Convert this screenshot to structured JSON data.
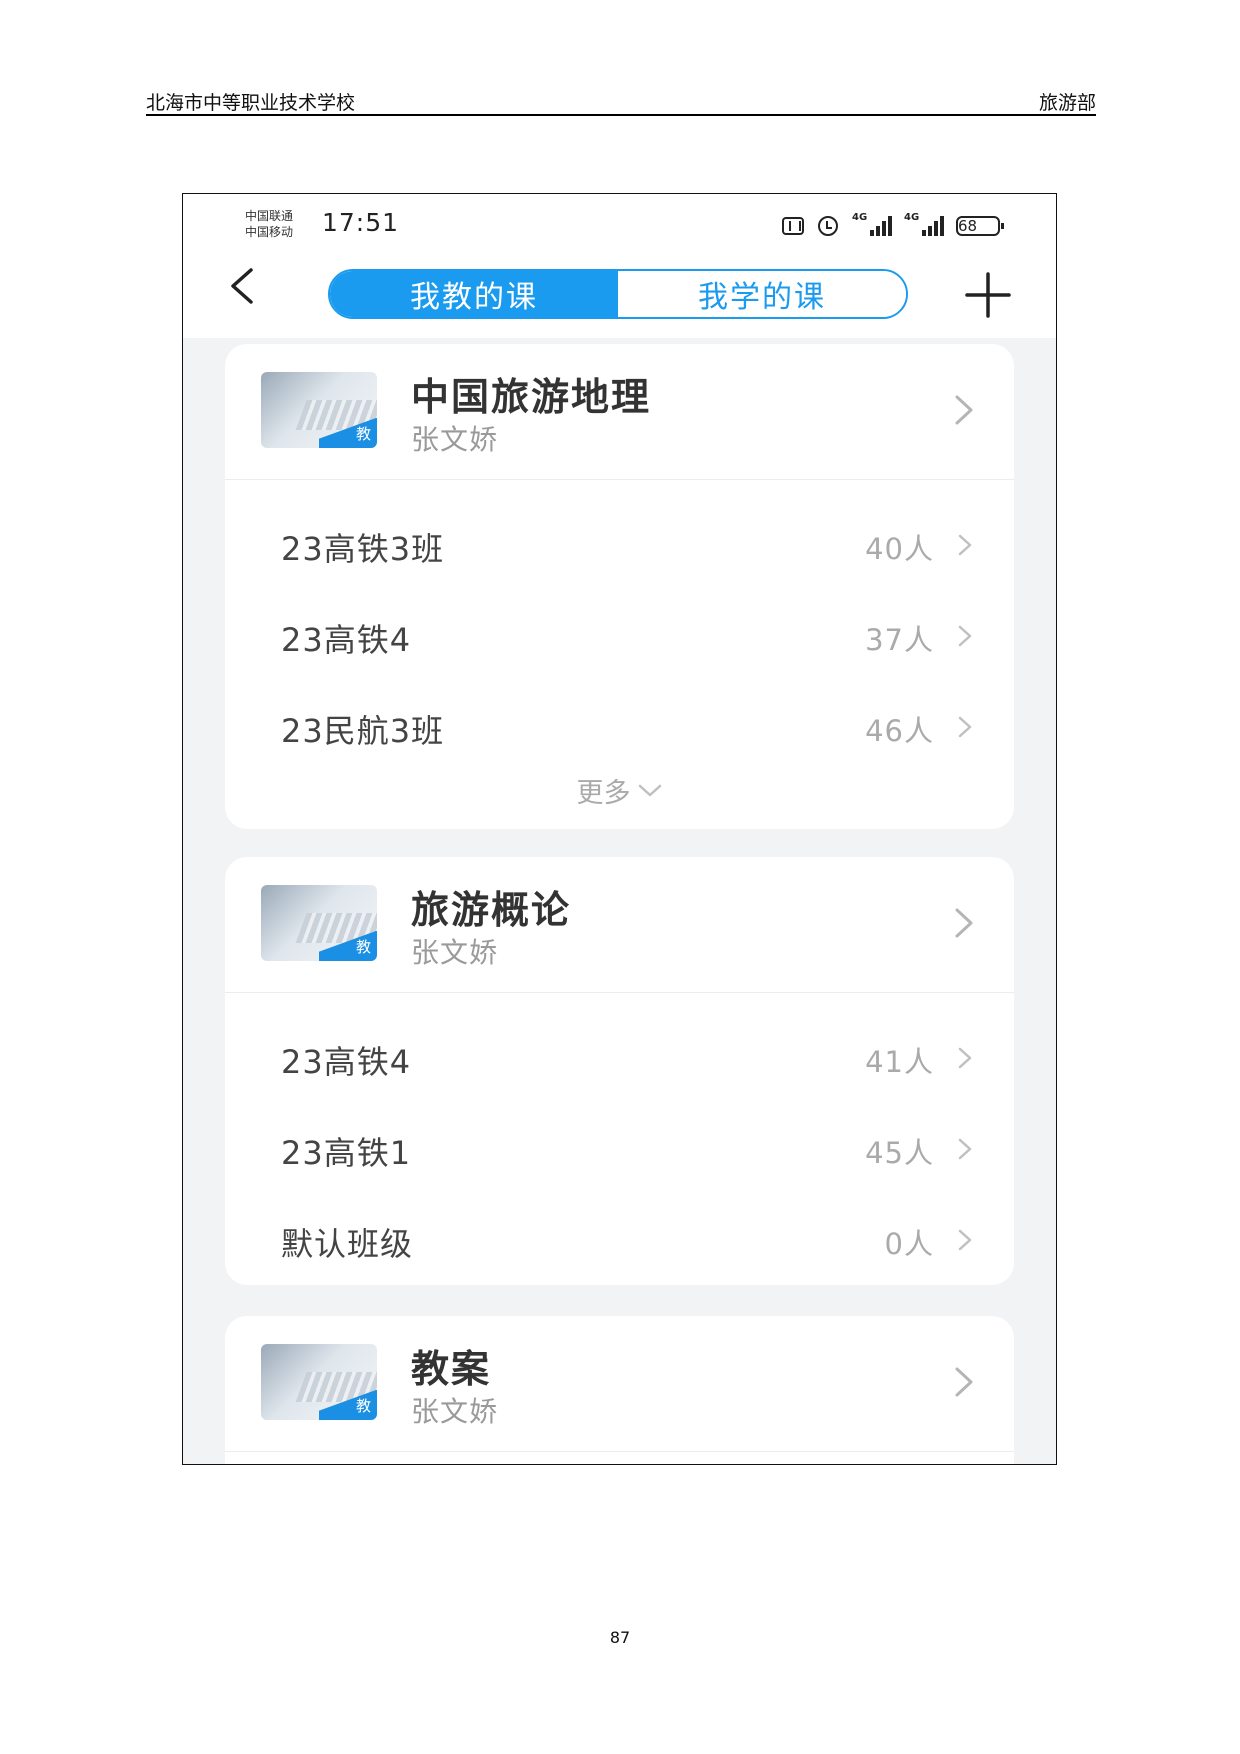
{
  "document": {
    "header_left": "北海市中等职业技术学校",
    "header_right": "旅游部",
    "page_number": "87"
  },
  "status_bar": {
    "carrier_1": "中国联通",
    "carrier_2": "中国移动",
    "time": "17:51",
    "network_1": "4G",
    "network_2": "4G",
    "battery": "68",
    "icons": [
      "nfc-icon",
      "alarm-icon",
      "signal-icon",
      "signal-icon",
      "battery-icon"
    ]
  },
  "nav": {
    "back_icon": "chevron-left-icon",
    "tabs": [
      {
        "label": "我教的课",
        "active": true
      },
      {
        "label": "我学的课",
        "active": false
      }
    ],
    "add_icon": "plus-icon",
    "accent_color": "#1a9bf0"
  },
  "courses": [
    {
      "title": "中国旅游地理",
      "teacher": "张文娇",
      "badge": "教",
      "classes": [
        {
          "name": "23高铁3班",
          "count": "40人"
        },
        {
          "name": "23高铁4",
          "count": "37人"
        },
        {
          "name": "23民航3班",
          "count": "46人"
        }
      ],
      "more_label": "更多"
    },
    {
      "title": "旅游概论",
      "teacher": "张文娇",
      "badge": "教",
      "classes": [
        {
          "name": "23高铁4",
          "count": "41人"
        },
        {
          "name": "23高铁1",
          "count": "45人"
        },
        {
          "name": "默认班级",
          "count": "0人"
        }
      ]
    },
    {
      "title": "教案",
      "teacher": "张文娇",
      "badge": "教",
      "classes": []
    }
  ]
}
